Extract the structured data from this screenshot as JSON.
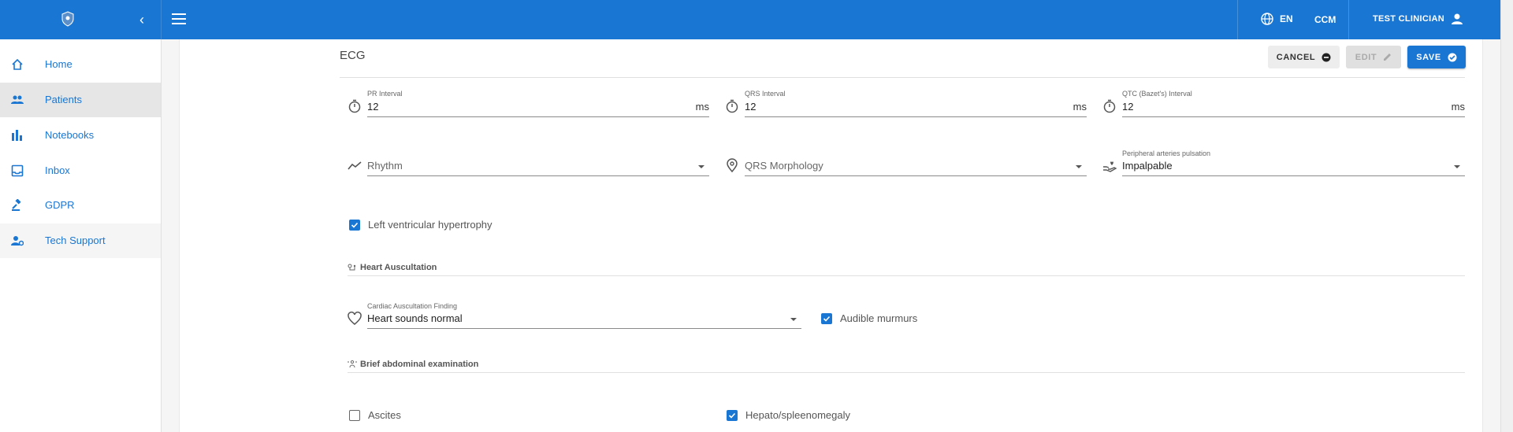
{
  "topbar": {
    "lang": "EN",
    "ccm": "CCM",
    "user": "TEST CLINICIAN",
    "icons": {
      "logo": "shield-logo",
      "collapse": "chevron-left-icon",
      "menu": "hamburger-icon",
      "globe": "globe-icon",
      "user": "person-icon"
    }
  },
  "sidebar": {
    "items": [
      {
        "label": "Home",
        "icon": "home-icon"
      },
      {
        "label": "Patients",
        "icon": "people-icon"
      },
      {
        "label": "Notebooks",
        "icon": "bar-chart-icon"
      },
      {
        "label": "Inbox",
        "icon": "inbox-icon"
      },
      {
        "label": "GDPR",
        "icon": "gavel-icon"
      },
      {
        "label": "Tech Support",
        "icon": "support-agent-icon"
      }
    ]
  },
  "section": {
    "title": "ECG",
    "buttons": {
      "cancel": "CANCEL",
      "edit": "EDIT",
      "save": "SAVE"
    }
  },
  "ecg": {
    "pr": {
      "label": "PR Interval",
      "value": "12",
      "unit": "ms"
    },
    "qrs": {
      "label": "QRS Interval",
      "value": "12",
      "unit": "ms"
    },
    "qtc": {
      "label": "QTC (Bazet's) Interval",
      "value": "12",
      "unit": "ms"
    },
    "rhythm": {
      "placeholder": "Rhythm"
    },
    "qrs_morph": {
      "placeholder": "QRS Morphology"
    },
    "peripheral": {
      "label": "Peripheral arteries pulsation",
      "value": "Impalpable"
    },
    "lvh": {
      "label": "Left ventricular hypertrophy",
      "checked": true
    }
  },
  "heart": {
    "title": "Heart Auscultation",
    "finding": {
      "label": "Cardiac Auscultation Finding",
      "value": "Heart sounds normal"
    },
    "murmurs": {
      "label": "Audible murmurs",
      "checked": true
    }
  },
  "abdominal": {
    "title": "Brief abdominal examination",
    "ascites": {
      "label": "Ascites",
      "checked": false
    },
    "hepato": {
      "label": "Hepato/spleenomegaly",
      "checked": true
    }
  },
  "colors": {
    "primary": "#1976d2",
    "active_nav": "#e6e6e6"
  }
}
